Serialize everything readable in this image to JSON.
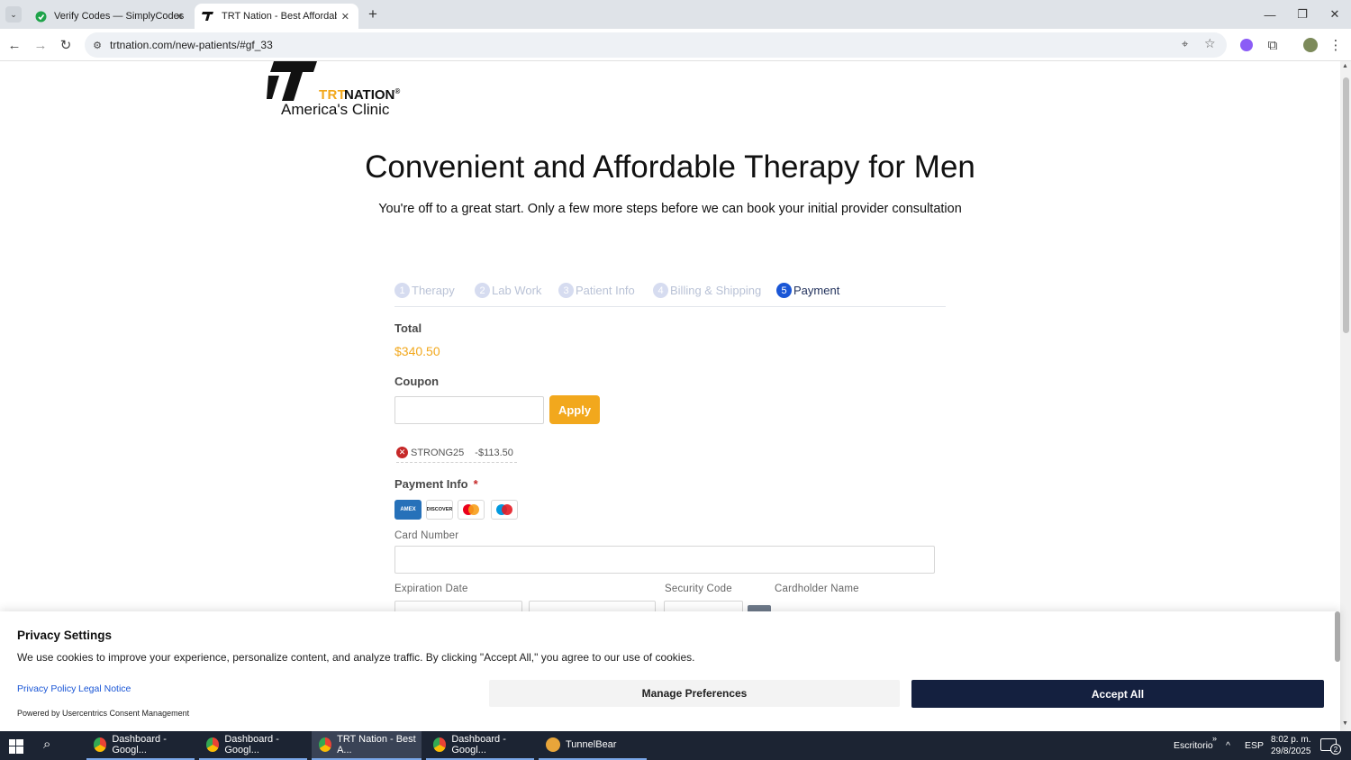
{
  "browser": {
    "tabs": [
      {
        "title": "Verify Codes — SimplyCodes"
      },
      {
        "title": "TRT Nation - Best Affordable T"
      }
    ],
    "url": "trtnation.com/new-patients/#gf_33"
  },
  "brand": {
    "trt": "TRT",
    "nation": "NATION",
    "trademark": "®",
    "tagline": "America's Clinic"
  },
  "page": {
    "headline": "Convenient and Affordable Therapy for Men",
    "subheadline": "You're off to a great start. Only a few more steps before we can book your initial provider consultation"
  },
  "steps": [
    {
      "num": "1",
      "label": "Therapy"
    },
    {
      "num": "2",
      "label": "Lab Work"
    },
    {
      "num": "3",
      "label": "Patient Info"
    },
    {
      "num": "4",
      "label": "Billing & Shipping"
    },
    {
      "num": "5",
      "label": "Payment"
    }
  ],
  "order": {
    "total_label": "Total",
    "total_value": "$340.50",
    "coupon_label": "Coupon",
    "apply_label": "Apply",
    "applied_code": "STRONG25",
    "applied_discount": "-$113.50"
  },
  "payment": {
    "section_label": "Payment Info",
    "required_mark": "*",
    "cards": [
      "AMEX",
      "DISCOVER",
      "mastercard",
      "maestro"
    ],
    "card_number_label": "Card Number",
    "expiration_label": "Expiration Date",
    "security_code_label": "Security Code",
    "cardholder_label": "Cardholder Name"
  },
  "cookie": {
    "title": "Privacy Settings",
    "text": "We use cookies to improve your experience, personalize content, and analyze traffic. By clicking \"Accept All,\" you agree to our use of cookies.",
    "privacy_link": "Privacy Policy",
    "legal_link": "Legal Notice",
    "powered_by": "Powered by Usercentrics Consent Management",
    "manage_label": "Manage Preferences",
    "accept_label": "Accept All"
  },
  "taskbar": {
    "apps": [
      {
        "label": "Dashboard - Googl..."
      },
      {
        "label": "Dashboard - Googl..."
      },
      {
        "label": "TRT Nation - Best A..."
      },
      {
        "label": "Dashboard - Googl..."
      },
      {
        "label": "TunnelBear"
      }
    ],
    "desktop_label": "Escritorio",
    "language": "ESP",
    "time": "8:02 p. m.",
    "date": "29/8/2025",
    "notification_count": "2"
  },
  "colors": {
    "accent_orange": "#f2a81d",
    "active_step_blue": "#1a56d6",
    "accept_navy": "#14203f"
  }
}
